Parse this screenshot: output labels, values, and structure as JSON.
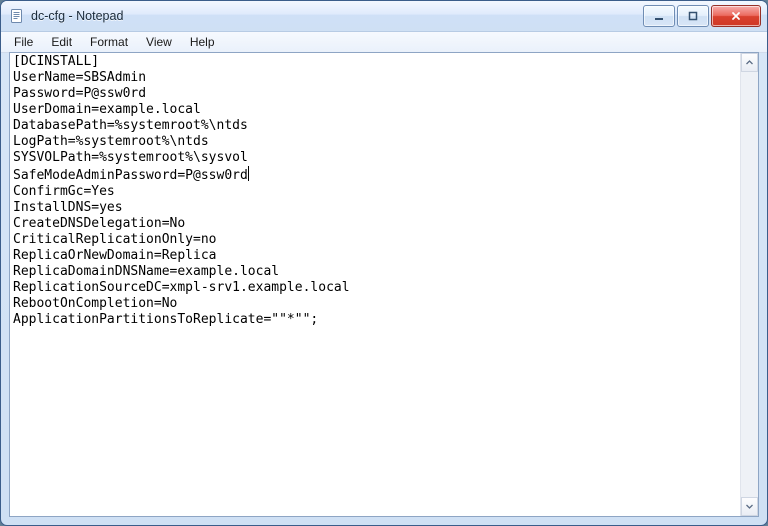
{
  "window": {
    "title": "dc-cfg - Notepad"
  },
  "menu": {
    "file": "File",
    "edit": "Edit",
    "format": "Format",
    "view": "View",
    "help": "Help"
  },
  "editor": {
    "lines": [
      "[DCINSTALL]",
      "UserName=SBSAdmin",
      "Password=P@ssw0rd",
      "UserDomain=example.local",
      "DatabasePath=%systemroot%\\ntds",
      "LogPath=%systemroot%\\ntds",
      "SYSVOLPath=%systemroot%\\sysvol",
      "SafeModeAdminPassword=P@ssw0rd",
      "ConfirmGc=Yes",
      "InstallDNS=yes",
      "CreateDNSDelegation=No",
      "CriticalReplicationOnly=no",
      "ReplicaOrNewDomain=Replica",
      "ReplicaDomainDNSName=example.local",
      "ReplicationSourceDC=xmpl-srv1.example.local",
      "RebootOnCompletion=No",
      "ApplicationPartitionsToReplicate=\"\"*\"\";"
    ],
    "caret_line": 7,
    "caret_col_end": true
  },
  "icons": {
    "app": "notepad-icon",
    "minimize": "minimize-icon",
    "maximize": "maximize-icon",
    "close": "close-icon",
    "scroll_up": "chevron-up-icon",
    "scroll_down": "chevron-down-icon"
  },
  "colors": {
    "chrome_top": "#dfeafc",
    "chrome_border": "#3b5d8a",
    "close_red": "#d9412f",
    "text_area_border": "#8ea5c4"
  }
}
